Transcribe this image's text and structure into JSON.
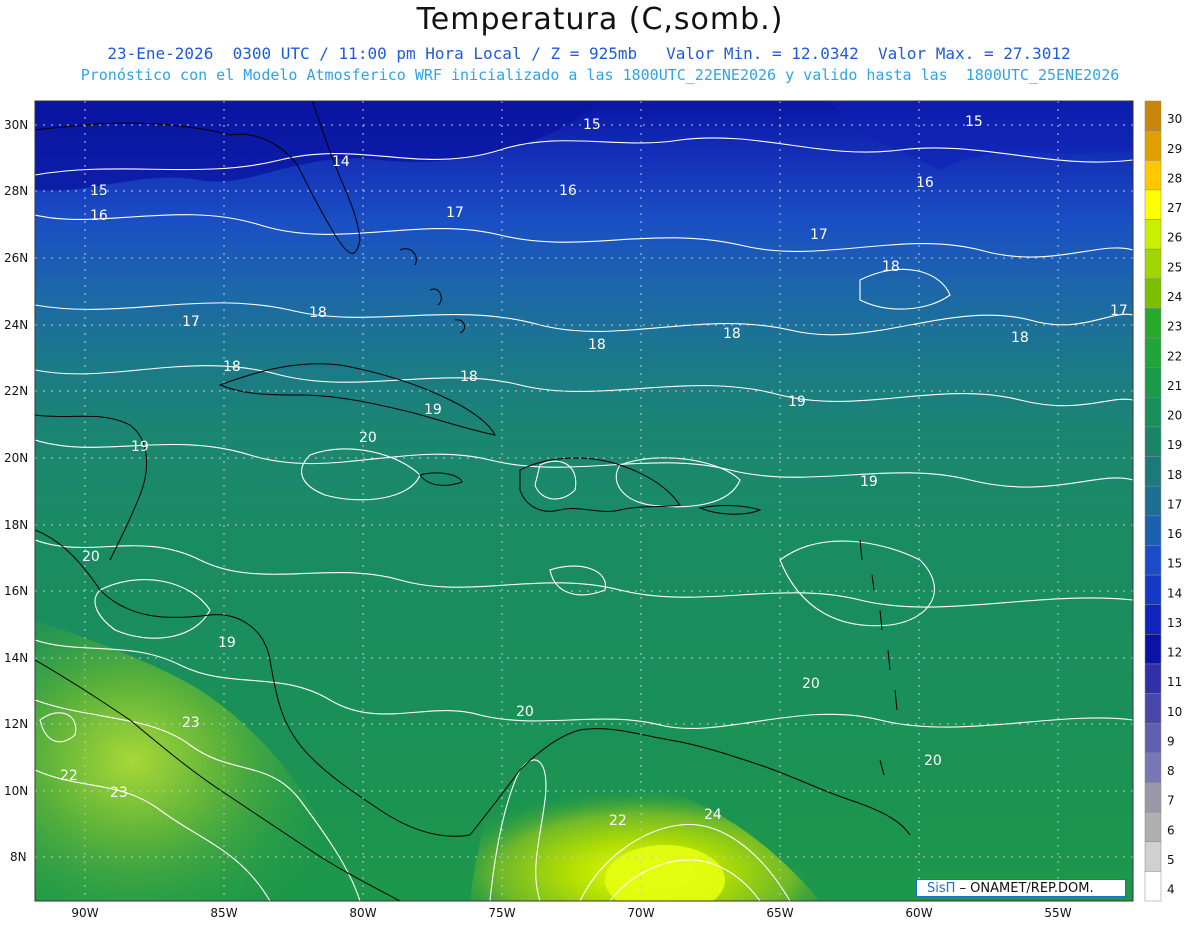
{
  "header": {
    "title": "Temperatura (C,somb.)",
    "line1": "23-Ene-2026  0300 UTC / 11:00 pm Hora Local / Z = 925mb   Valor Min. = 12.0342  Valor Max. = 27.3012",
    "line2": "Pronóstico con el Modelo Atmosferico WRF inicializado a las 1800UTC_22ENE2026 y valido hasta las  1800UTC_25ENE2026"
  },
  "map": {
    "lat_labels": [
      "30N",
      "28N",
      "26N",
      "24N",
      "22N",
      "20N",
      "18N",
      "16N",
      "14N",
      "12N",
      "10N",
      "8N"
    ],
    "lon_labels": [
      "90W",
      "85W",
      "80W",
      "75W",
      "70W",
      "65W",
      "60W",
      "55W"
    ],
    "contour_labels": [
      "15",
      "15",
      "14",
      "15",
      "16",
      "16",
      "16",
      "17",
      "17",
      "17",
      "17",
      "18",
      "18",
      "18",
      "18",
      "18",
      "18",
      "18",
      "19",
      "19",
      "19",
      "19",
      "19",
      "20",
      "20",
      "20",
      "20",
      "20",
      "22",
      "22",
      "23",
      "23",
      "24"
    ]
  },
  "colorbar": {
    "levels": [
      "30",
      "29",
      "28",
      "27",
      "26",
      "25",
      "24",
      "23",
      "22",
      "21",
      "20",
      "19",
      "18",
      "17",
      "16",
      "15",
      "14",
      "13",
      "12",
      "11",
      "10",
      "9",
      "8",
      "7",
      "6",
      "5",
      "4"
    ],
    "colors": [
      "#c8860a",
      "#e0a000",
      "#ffc800",
      "#ffff00",
      "#c8f000",
      "#a0d600",
      "#78c000",
      "#28a828",
      "#1fa53a",
      "#1b9b4a",
      "#1a8f5a",
      "#1b8468",
      "#1c7a78",
      "#1d6f92",
      "#1c60b0",
      "#1a4cc8",
      "#1438c8",
      "#0f24bc",
      "#0a12a8",
      "#3030a8",
      "#4848a8",
      "#6060b0",
      "#7878b8",
      "#9898a8",
      "#b0b0b0",
      "#d0d0d0",
      "#ffffff"
    ]
  },
  "badge": {
    "sis": "SisΠ",
    "org": " – ONAMET/REP.DOM."
  }
}
